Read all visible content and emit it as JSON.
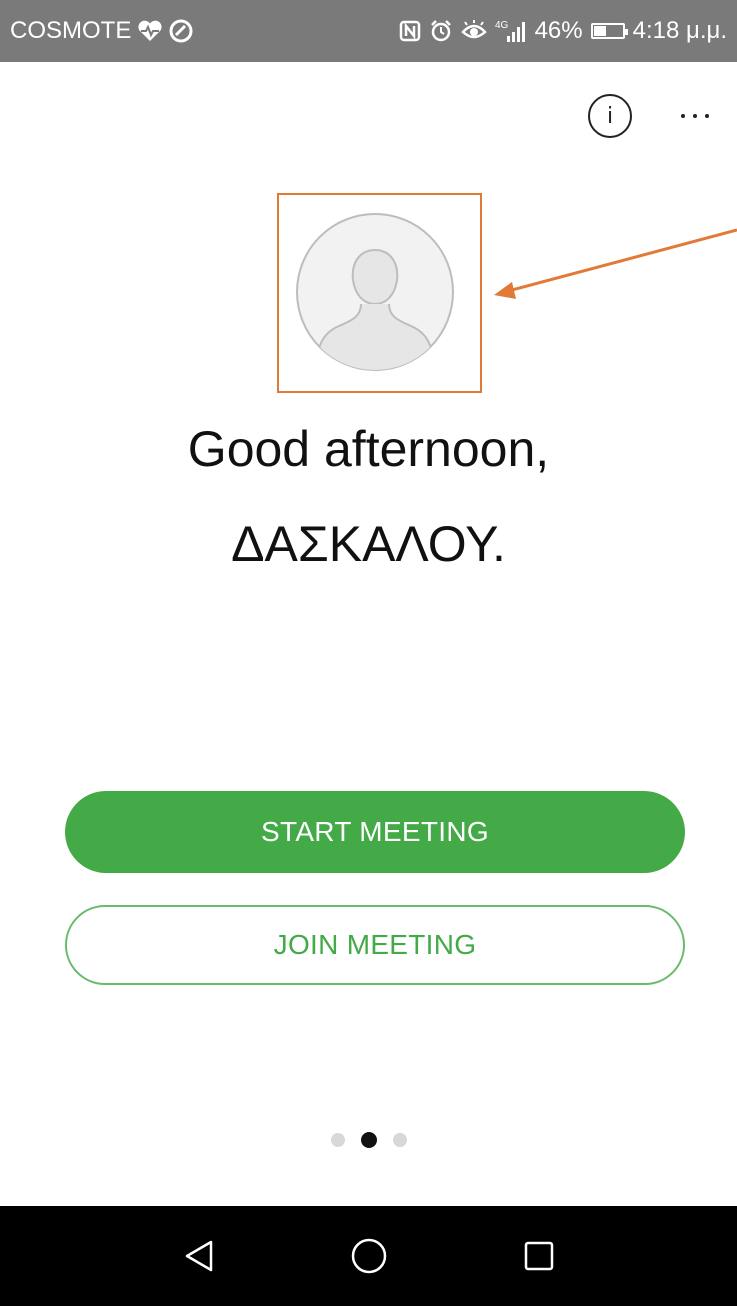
{
  "status_bar": {
    "carrier": "COSMOTE",
    "network": "4G",
    "battery_percent": "46%",
    "battery_level": 0.46,
    "time": "4:18 μ.μ.",
    "icons": [
      "heart-icon",
      "sync-icon",
      "nfc-icon",
      "alarm-icon",
      "eye-icon",
      "signal-icon",
      "battery-icon"
    ]
  },
  "top_actions": {
    "info_label": "i",
    "more_icon": "more-horizontal-icon"
  },
  "greeting": {
    "line1": "Good afternoon,",
    "line2": "ΔΑΣΚΑΛΟΥ."
  },
  "buttons": {
    "start": "START MEETING",
    "join": "JOIN MEETING"
  },
  "pager": {
    "count": 3,
    "active_index": 1
  },
  "nav_bar": {
    "items": [
      "back-icon",
      "home-icon",
      "recents-icon"
    ]
  },
  "colors": {
    "status_bar": "#7a7a7a",
    "primary_green": "#43aa47",
    "outline_green": "#68bb6b",
    "annotation": "#e07a36",
    "nav_bar": "#000000"
  }
}
